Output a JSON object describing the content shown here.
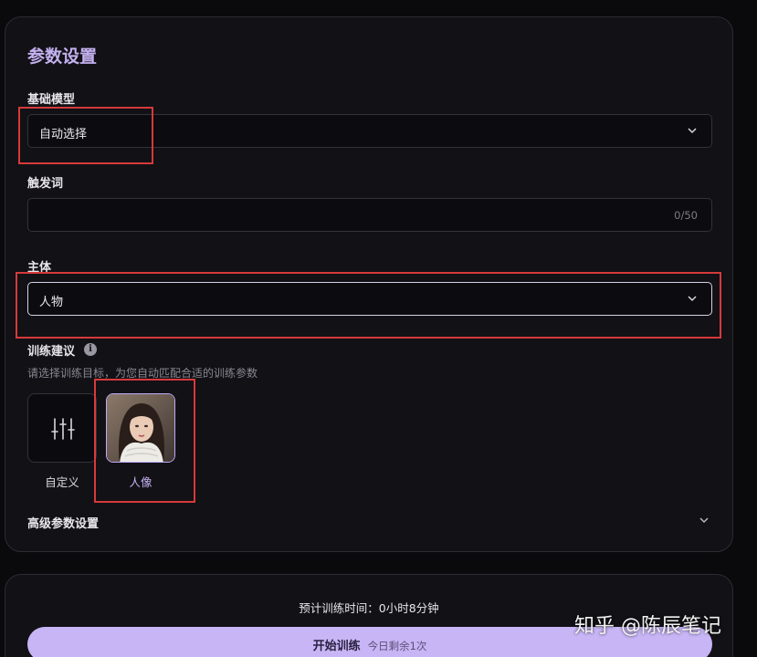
{
  "panel": {
    "title": "参数设置",
    "base_model": {
      "label": "基础模型",
      "value": "自动选择"
    },
    "trigger_word": {
      "label": "触发词",
      "value": "",
      "counter": "0/50"
    },
    "subject": {
      "label": "主体",
      "value": "人物"
    },
    "training_advice": {
      "label": "训练建议",
      "info_icon": "info-icon",
      "hint": "请选择训练目标，为您自动匹配合适的训练参数",
      "presets": [
        {
          "label": "自定义",
          "icon": "sliders-icon",
          "selected": false
        },
        {
          "label": "人像",
          "icon": "portrait-thumbnail",
          "selected": true
        }
      ]
    },
    "advanced": {
      "label": "高级参数设置"
    }
  },
  "footer": {
    "eta": "预计训练时间：0小时8分钟",
    "train_button": "开始训练",
    "remaining": "今日剩余1次"
  },
  "watermark": "知乎 @陈辰笔记",
  "colors": {
    "accent": "#c4b1f0",
    "button_bg": "#c7b5f5",
    "panel_bg": "#121116",
    "highlight_box": "#d63a3a"
  }
}
